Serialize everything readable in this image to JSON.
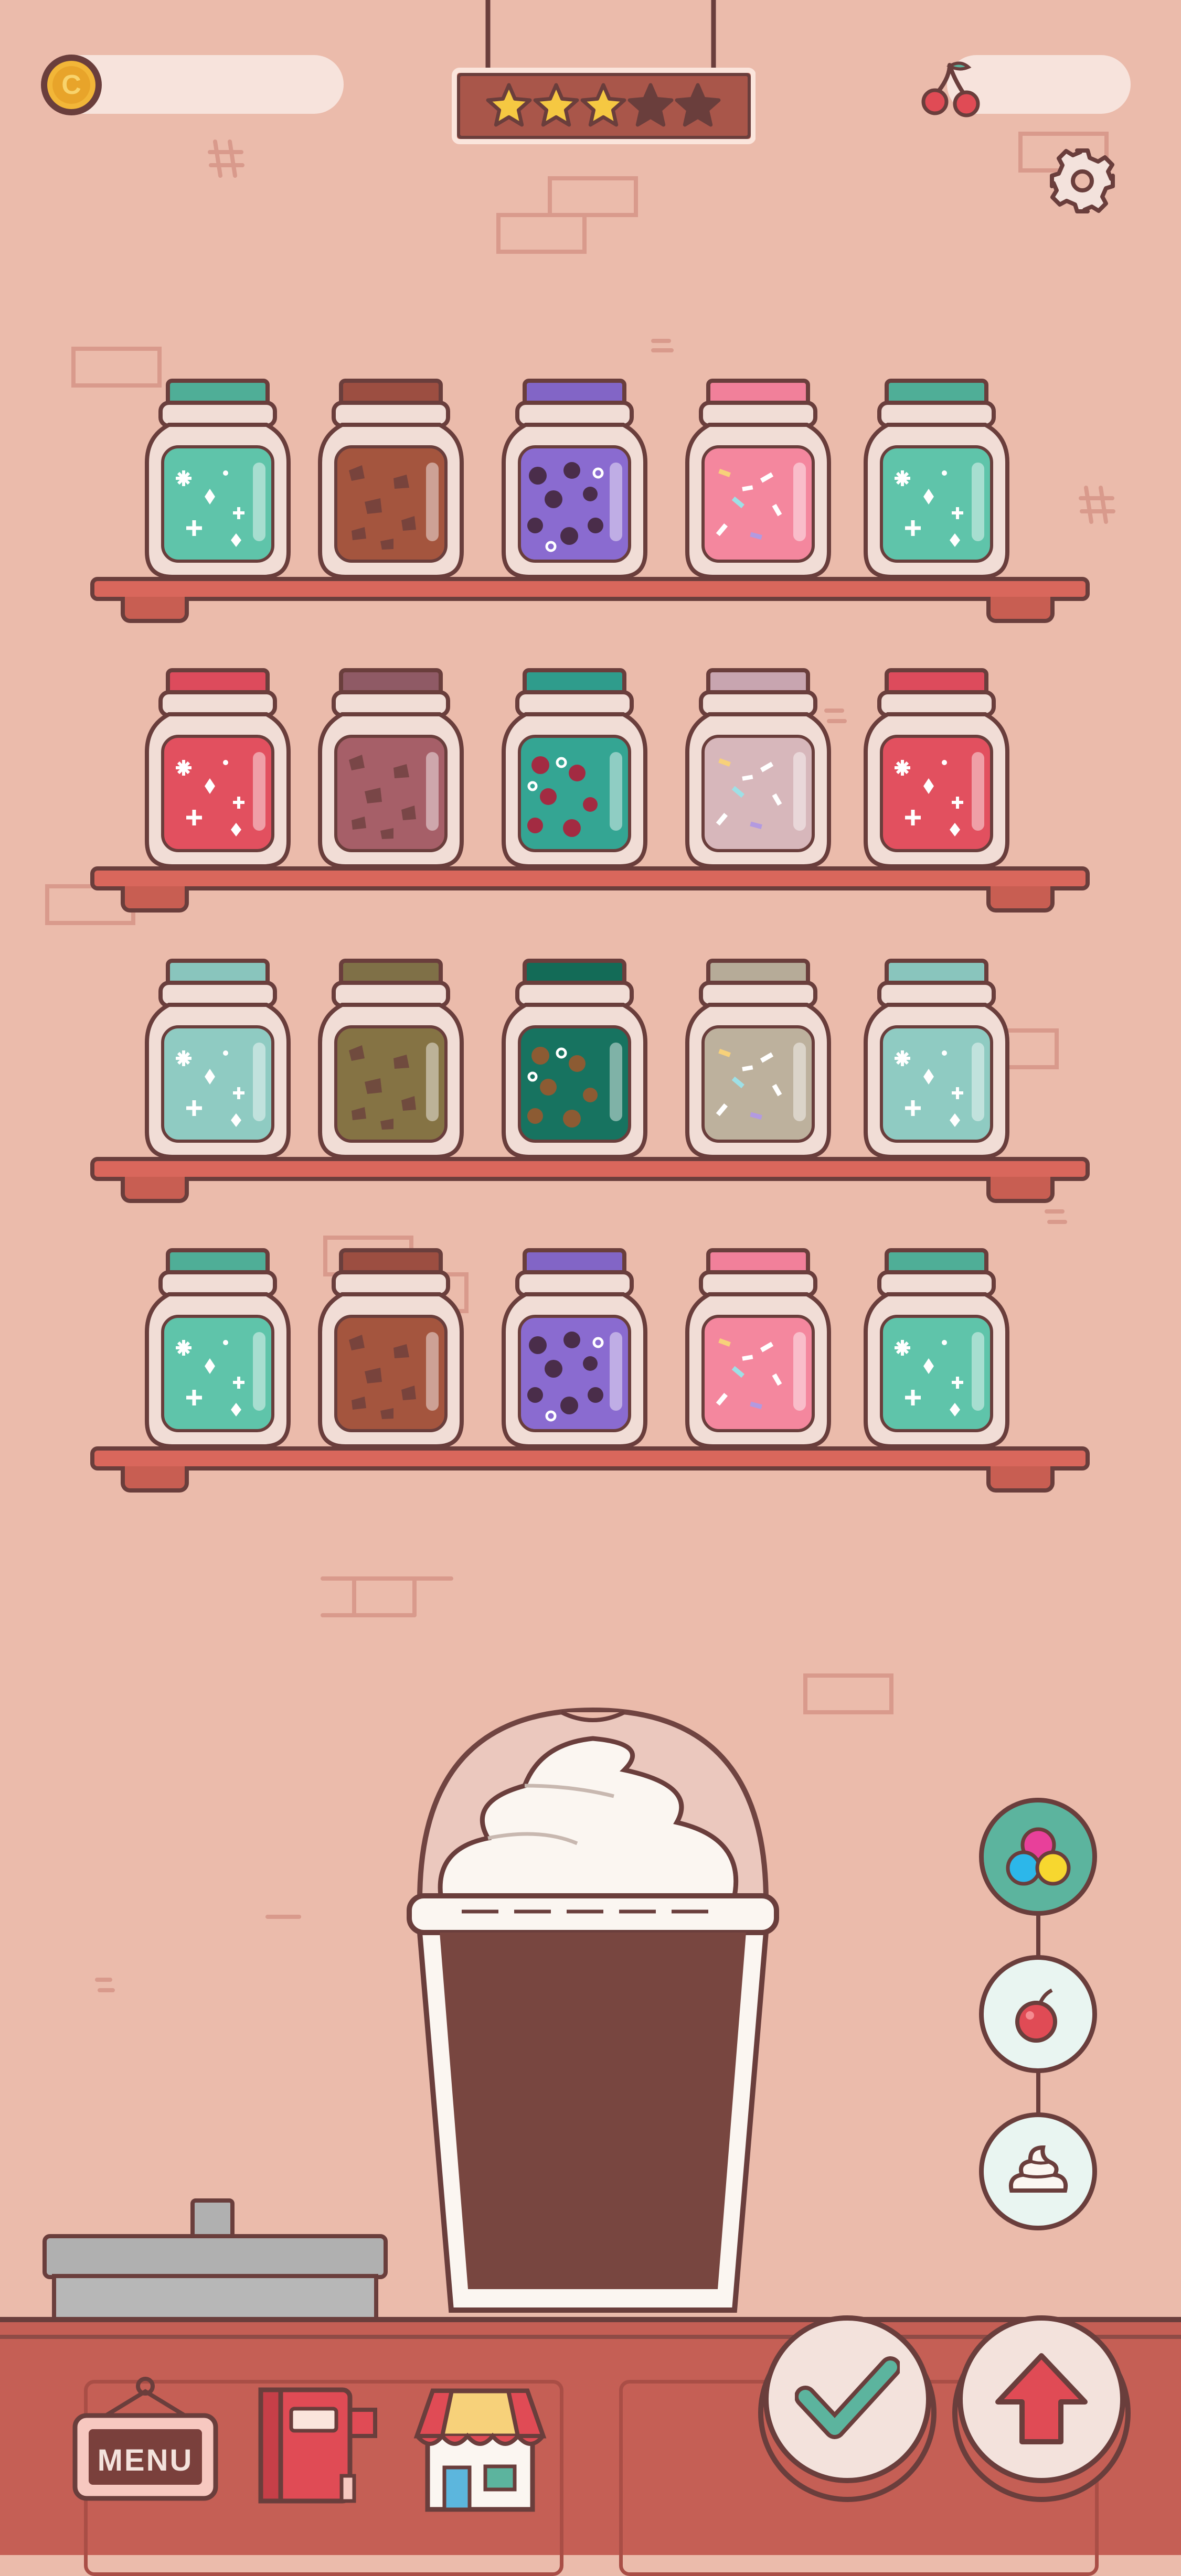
{
  "hud": {
    "coin_icon": "coin-icon",
    "coin_letter": "C",
    "coin_value": "",
    "cherry_icon": "cherry-icon",
    "cherry_value": "",
    "rating": {
      "filled": 3,
      "total": 5
    },
    "settings_icon": "gear-icon"
  },
  "shelves": [
    {
      "jars": [
        {
          "lid": "#4fae97",
          "fill": "#5fc4aa",
          "pattern": "sparkle"
        },
        {
          "lid": "#9c4e41",
          "fill": "#a4553e",
          "pattern": "chips"
        },
        {
          "lid": "#8265c6",
          "fill": "#8a6bd0",
          "pattern": "dots"
        },
        {
          "lid": "#f1809a",
          "fill": "#f4879e",
          "pattern": "sprinkles"
        },
        {
          "lid": "#4fae97",
          "fill": "#5fc4aa",
          "pattern": "sparkle"
        }
      ]
    },
    {
      "jars": [
        {
          "lid": "#dd4b5c",
          "fill": "#e2505f",
          "pattern": "sparkle"
        },
        {
          "lid": "#8f5a65",
          "fill": "#a65f68",
          "pattern": "chips"
        },
        {
          "lid": "#2f9c8c",
          "fill": "#34a593",
          "pattern": "dots-red"
        },
        {
          "lid": "#c8a5b0",
          "fill": "#d7b7bb",
          "pattern": "sprinkles"
        },
        {
          "lid": "#dd4b5c",
          "fill": "#e2505f",
          "pattern": "sparkle"
        }
      ]
    },
    {
      "jars": [
        {
          "lid": "#89c5bd",
          "fill": "#8fcbc2",
          "pattern": "sparkle"
        },
        {
          "lid": "#7f7047",
          "fill": "#857344",
          "pattern": "chips"
        },
        {
          "lid": "#136b57",
          "fill": "#177360",
          "pattern": "dots-brown"
        },
        {
          "lid": "#b6ab98",
          "fill": "#bdb19d",
          "pattern": "sprinkles"
        },
        {
          "lid": "#89c5bd",
          "fill": "#8fcbc2",
          "pattern": "sparkle"
        }
      ]
    },
    {
      "jars": [
        {
          "lid": "#4fae97",
          "fill": "#5fc4aa",
          "pattern": "sparkle"
        },
        {
          "lid": "#9c4e41",
          "fill": "#a4553e",
          "pattern": "chips"
        },
        {
          "lid": "#8265c6",
          "fill": "#8a6bd0",
          "pattern": "dots"
        },
        {
          "lid": "#f1809a",
          "fill": "#f4879e",
          "pattern": "sprinkles"
        },
        {
          "lid": "#4fae97",
          "fill": "#5fc4aa",
          "pattern": "sparkle"
        }
      ]
    }
  ],
  "drink": {
    "cup_fill": "#784640",
    "whipped_cream": "#fbf6f1",
    "dome": "#ebc9c0"
  },
  "topping_options": [
    {
      "name": "gumballs-topping-icon",
      "selected": true
    },
    {
      "name": "cherry-topping-icon",
      "selected": false
    },
    {
      "name": "whipped-cream-topping-icon",
      "selected": false
    }
  ],
  "bottom_bar": {
    "menu_label": "MENU",
    "recipe_book_icon": "recipe-book-icon",
    "shop_icon": "shop-icon",
    "confirm_icon": "checkmark-icon",
    "upgrade_icon": "up-arrow-icon"
  },
  "colors": {
    "background": "#ebbbab",
    "outline": "#6a3e3c",
    "shelf": "#d9675c",
    "counter": "#c55f55",
    "accent_green": "#5cb49e"
  }
}
